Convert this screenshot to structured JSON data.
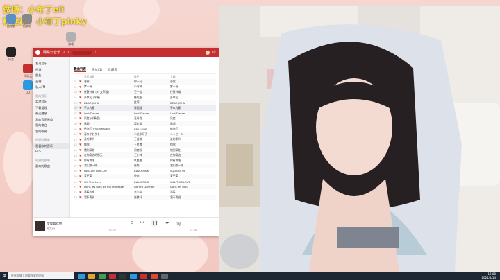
{
  "overlay": {
    "line1": "微博：小布丁eli",
    "line2": "粉丝群：小布丁pinky"
  },
  "colors": {
    "brand": "#c62f2f",
    "desktop_bg": "#f2c9c2"
  },
  "desktop_icons": [
    {
      "name": "此电脑",
      "color": "#5a8fc7"
    },
    {
      "name": "回收站",
      "color": "#888"
    },
    {
      "name": "网易云",
      "color": "#c62f2f"
    },
    {
      "name": "QQ",
      "color": "#2a9be0"
    },
    {
      "name": "抖音",
      "color": "#222"
    },
    {
      "name": "游戏",
      "color": "#b0b0b0"
    }
  ],
  "music_app": {
    "title": "网易云音乐",
    "sidebar": [
      {
        "label": "发现音乐"
      },
      {
        "label": "视频"
      },
      {
        "label": "朋友"
      },
      {
        "label": "直播"
      },
      {
        "label": "私人FM"
      },
      {
        "label": "我的音乐",
        "head": true
      },
      {
        "label": "本地音乐"
      },
      {
        "label": "下载管理"
      },
      {
        "label": "最近播放"
      },
      {
        "label": "我的音乐云盘"
      },
      {
        "label": "我的电台"
      },
      {
        "label": "我的收藏"
      },
      {
        "label": "创建的歌单",
        "head": true
      },
      {
        "label": "我喜欢的音乐",
        "selected": true
      },
      {
        "label": "ETS"
      },
      {
        "label": "收藏的歌单",
        "head": true
      },
      {
        "label": "喜欢的歌曲"
      }
    ],
    "tabs": [
      "歌曲列表",
      "评论(1)",
      "收藏者"
    ],
    "columns": [
      "",
      "",
      "音乐标题",
      "歌手",
      "专辑"
    ],
    "songs": [
      {
        "title": "答案",
        "artist": "郭一凡",
        "album": "答案"
      },
      {
        "title": "梦一场",
        "artist": "小阿枫",
        "album": "梦一场"
      },
      {
        "title": "任意外滩 (ft. 女声版)",
        "artist": "王一佳",
        "album": "任意外滩"
      },
      {
        "title": "多幸运 (伴奏)",
        "artist": "韩安旭",
        "album": "多幸运"
      },
      {
        "title": "DEAR JOHN",
        "artist": "比莉",
        "album": "DEAR JOHN"
      },
      {
        "title": "不以为意",
        "artist": "泰国版",
        "album": "不以为意"
      },
      {
        "title": "Lost Dance",
        "artist": "Lost Dance",
        "album": "Lost Dance"
      },
      {
        "title": "风度 (伴奏版)",
        "artist": "汪苏泷",
        "album": "风度"
      },
      {
        "title": "悬溺",
        "artist": "葛东琪",
        "album": "悬溺"
      },
      {
        "title": "给你们 (Full Version)",
        "artist": "KEY LOVE",
        "album": "给你们"
      },
      {
        "title": "春のかおりを",
        "artist": "小松未可子",
        "album": "メッセージ"
      },
      {
        "title": "谁的季节",
        "artist": "王若琳",
        "album": "谁的季节"
      },
      {
        "title": "懂你",
        "artist": "王贰浪",
        "album": "懂你"
      },
      {
        "title": "错到深处",
        "artist": "周笔畅",
        "album": "错到深处"
      },
      {
        "title": "在你身边的那天",
        "artist": "王小帅",
        "album": "在你身边"
      },
      {
        "title": "你有病吧",
        "artist": "玖壹壹",
        "album": "你有病吧"
      },
      {
        "title": "我们都一样",
        "artist": "张杰",
        "album": "我们都一样"
      },
      {
        "title": "DDU-DU DDU-DU",
        "artist": "BLACKPINK",
        "album": "SQUARE UP"
      },
      {
        "title": "爱不爱",
        "artist": "朴树",
        "album": "爱不爱"
      },
      {
        "title": "Kill This Love",
        "artist": "BLACKPINK",
        "album": "KILL THIS LOVE"
      },
      {
        "title": "Dans les rues de ma jeunesse",
        "artist": "Gérard Darmon",
        "album": "Dans les rues"
      },
      {
        "title": "温柔的夜",
        "artist": "李心洁",
        "album": "温柔"
      },
      {
        "title": "我不再说",
        "artist": "张敬轩",
        "album": "我不再说"
      }
    ],
    "playing_index": 5,
    "player": {
      "title": "慢慢喜欢你",
      "artist": "莫文蔚",
      "time_current": "00:32",
      "time_total": "03:36",
      "progress": 0.15
    }
  },
  "taskbar": {
    "search_placeholder": "在这里输入你要搜索的内容",
    "apps": [
      "#2a9be0",
      "#e8a12a",
      "#4a9b4a",
      "#c62f2f",
      "#333",
      "#2a9be0",
      "#c62f2f",
      "#e04a2a",
      "#666"
    ],
    "time": "12:00",
    "date": "2021/4/14"
  }
}
